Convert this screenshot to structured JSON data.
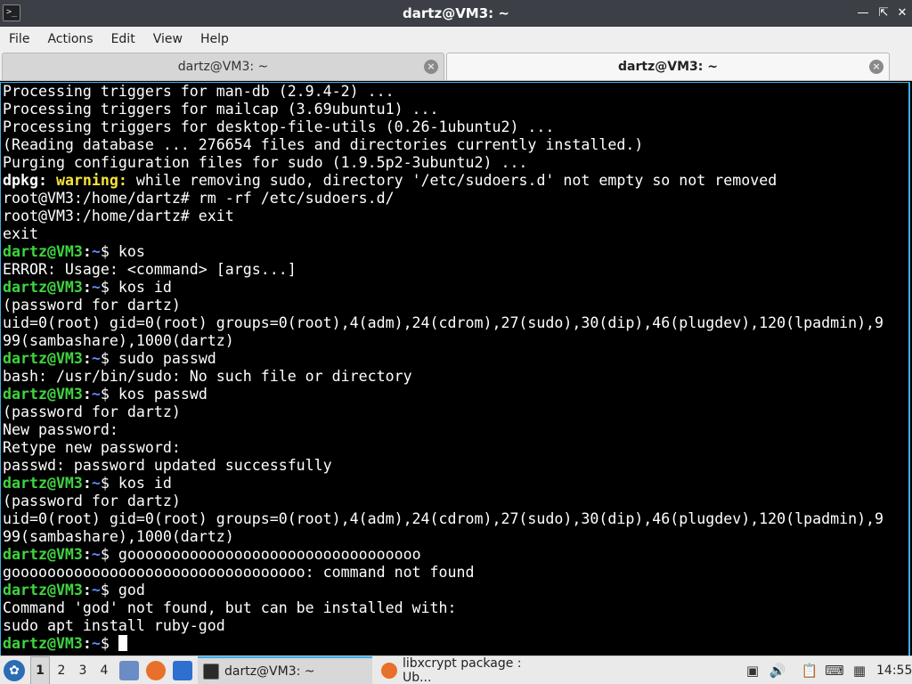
{
  "window": {
    "title": "dartz@VM3: ~",
    "icon": "terminal-icon",
    "controls": [
      "minimize-icon",
      "maximize-icon",
      "close-icon"
    ]
  },
  "menu": [
    "File",
    "Actions",
    "Edit",
    "View",
    "Help"
  ],
  "tabs": [
    {
      "label": "dartz@VM3: ~",
      "active": false
    },
    {
      "label": "dartz@VM3: ~",
      "active": true
    }
  ],
  "terminal": {
    "colors": {
      "background": "#000000",
      "text": "#ffffff",
      "user": "#3fd43f",
      "path": "#5c8bff",
      "warning": "#f6e23c"
    },
    "prompt": {
      "user": "dartz@VM3",
      "sep": ":",
      "path": "~",
      "symbol": "$ "
    },
    "lines": [
      {
        "t": "Processing triggers for man-db (2.9.4-2) ..."
      },
      {
        "t": "Processing triggers for mailcap (3.69ubuntu1) ..."
      },
      {
        "t": "Processing triggers for desktop-file-utils (0.26-1ubuntu2) ..."
      },
      {
        "t": "(Reading database ... 276654 files and directories currently installed.)"
      },
      {
        "t": "Purging configuration files for sudo (1.9.5p2-3ubuntu2) ..."
      },
      {
        "warn": true,
        "pre": "dpkg:",
        "w": "warning:",
        "t": " while removing sudo, directory '/etc/sudoers.d' not empty so not removed"
      },
      {
        "t": "root@VM3:/home/dartz# rm -rf /etc/sudoers.d/"
      },
      {
        "t": "root@VM3:/home/dartz# exit"
      },
      {
        "t": "exit"
      },
      {
        "p": true,
        "t": "kos"
      },
      {
        "t": "ERROR: Usage: <command> [args...]"
      },
      {
        "p": true,
        "t": "kos id"
      },
      {
        "t": "(password for dartz)"
      },
      {
        "t": "uid=0(root) gid=0(root) groups=0(root),4(adm),24(cdrom),27(sudo),30(dip),46(plugdev),120(lpadmin),9"
      },
      {
        "t": "99(sambashare),1000(dartz)"
      },
      {
        "p": true,
        "t": "sudo passwd"
      },
      {
        "t": "bash: /usr/bin/sudo: No such file or directory"
      },
      {
        "p": true,
        "t": "kos passwd"
      },
      {
        "t": "(password for dartz)"
      },
      {
        "t": "New password:"
      },
      {
        "t": "Retype new password:"
      },
      {
        "t": "passwd: password updated successfully"
      },
      {
        "p": true,
        "t": "kos id"
      },
      {
        "t": "(password for dartz)"
      },
      {
        "t": "uid=0(root) gid=0(root) groups=0(root),4(adm),24(cdrom),27(sudo),30(dip),46(plugdev),120(lpadmin),9"
      },
      {
        "t": "99(sambashare),1000(dartz)"
      },
      {
        "p": true,
        "t": "gooooooooooooooooooooooooooooooooo"
      },
      {
        "t": "gooooooooooooooooooooooooooooooooo: command not found"
      },
      {
        "p": true,
        "t": "god"
      },
      {
        "t": "Command 'god' not found, but can be installed with:"
      },
      {
        "t": "sudo apt install ruby-god"
      },
      {
        "p": true,
        "t": "",
        "cursor": true
      }
    ]
  },
  "taskbar": {
    "start_icon": "lubuntu-menu-icon",
    "workspaces": [
      "1",
      "2",
      "3",
      "4"
    ],
    "active_workspace": "1",
    "quicklaunch": [
      "file-manager-icon",
      "firefox-icon",
      "desktop-icon"
    ],
    "tasks": [
      {
        "label": "dartz@VM3: ~",
        "icon": "terminal-icon",
        "active": true
      },
      {
        "label": "libxcrypt package : Ub...",
        "icon": "firefox-icon",
        "active": false
      }
    ],
    "tray": [
      "display-icon",
      "volume-icon",
      "clipboard-icon",
      "keyboard-icon",
      "network-icon"
    ],
    "clock": "14:55"
  }
}
